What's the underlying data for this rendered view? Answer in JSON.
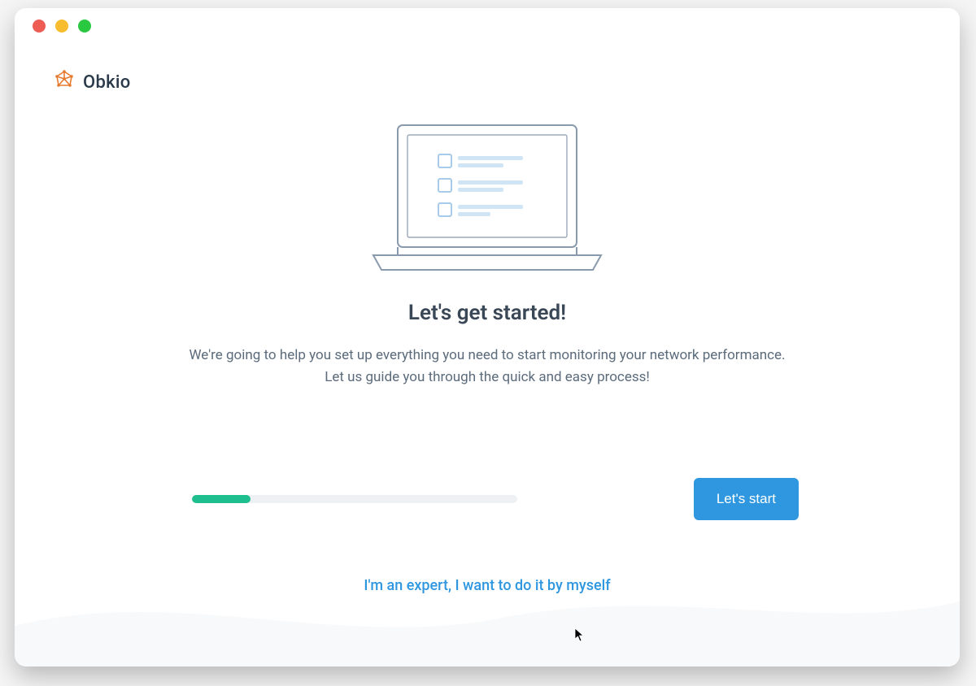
{
  "brand": {
    "name": "Obkio",
    "logo_color": "#e67a2e"
  },
  "onboarding": {
    "heading": "Let's get started!",
    "subtext": "We're going to help you set up everything you need to start monitoring your network performance. Let us guide you through the quick and easy process!",
    "progress_percent": 18,
    "primary_button_label": "Let's start",
    "expert_link_label": "I'm an expert, I want to do it by myself"
  },
  "colors": {
    "accent_blue": "#2f97e0",
    "accent_green": "#1ebe8e",
    "text_primary": "#3a4756",
    "text_secondary": "#5b6b7b",
    "illustration_stroke": "#8a9aad",
    "illustration_fill": "#cfe5f5"
  }
}
